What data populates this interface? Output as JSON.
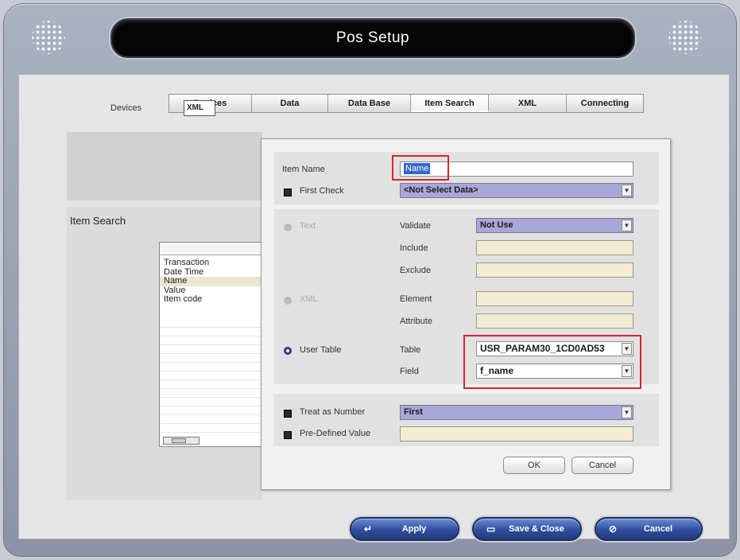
{
  "window": {
    "title": "Pos Setup"
  },
  "tabs": [
    "Devices",
    "Data",
    "Data Base",
    "Item Search",
    "XML",
    "Connecting"
  ],
  "left_panel": {
    "devices_label": "Devices",
    "devices_value": "XML",
    "section_title": "Item Search",
    "list_items": [
      "Transaction",
      "Date Time",
      "Name",
      "Value",
      "Item code"
    ],
    "selected_item": "Name"
  },
  "dialog": {
    "item_name_label": "Item Name",
    "item_name_value": "Name",
    "first_check_label": "First Check",
    "first_check_value": "<Not Select Data>",
    "text_label": "Text",
    "validate_label": "Validate",
    "validate_value": "Not Use",
    "include_label": "Include",
    "exclude_label": "Exclude",
    "xml_label": "XML",
    "element_label": "Element",
    "attribute_label": "Attribute",
    "user_table_label": "User Table",
    "table_label": "Table",
    "table_value": "USR_PARAM30_1CD0AD53",
    "field_label": "Field",
    "field_value": "f_name",
    "treat_number_label": "Treat as Number",
    "treat_number_value": "First",
    "predefined_label": "Pre-Defined Value",
    "ok_label": "OK",
    "cancel_label": "Cancel"
  },
  "footer": {
    "apply_label": "Apply",
    "save_close_label": "Save & Close",
    "cancel_label": "Cancel"
  },
  "colors": {
    "highlight_box": "#d9242c",
    "pill_button": "#2e4f9e",
    "field_beige": "#f2ecd2",
    "field_purple": "#a9a7d8"
  },
  "icons": [
    "speaker-grille-icon",
    "dropdown-arrow-icon",
    "apply-arrow-icon",
    "save-icon",
    "cancel-icon"
  ]
}
